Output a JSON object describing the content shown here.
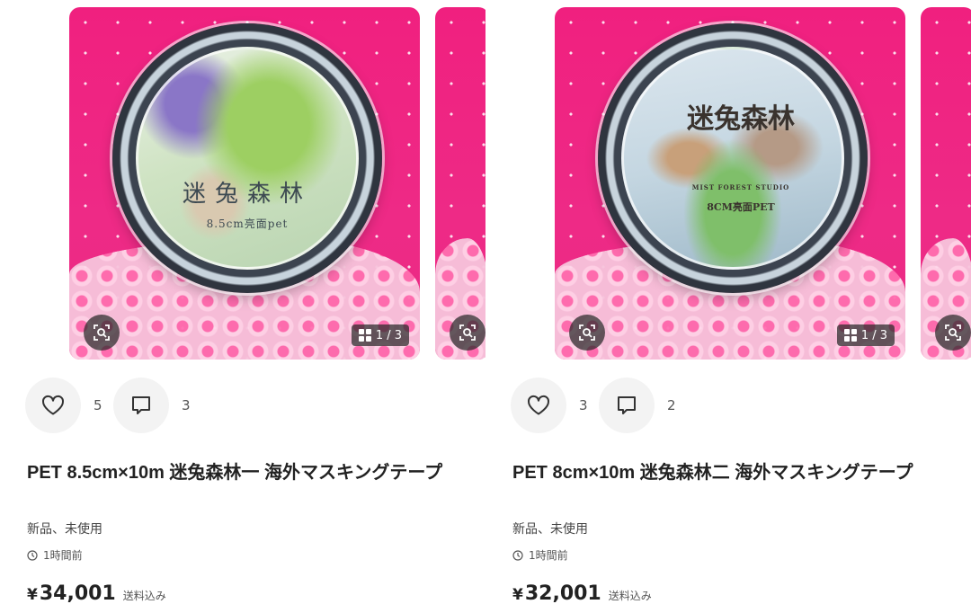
{
  "items": [
    {
      "image": {
        "tape_title": "迷兔森林",
        "tape_subtitle": "8.5cm亮面pet",
        "counter": "1 / 3"
      },
      "likes": "5",
      "comments": "3",
      "title": "PET 8.5cm×10m 迷兔森林一 海外マスキングテープ",
      "condition": "新品、未使用",
      "time": "1時間前",
      "price_symbol": "¥",
      "price": "34,001",
      "shipping": "送料込み"
    },
    {
      "image": {
        "tape_title": "迷兔森林",
        "tape_studio": "MIST FOREST STUDIO",
        "tape_subtitle": "8CM亮面PET",
        "counter": "1 / 3"
      },
      "likes": "3",
      "comments": "2",
      "title": "PET 8cm×10m 迷兔森林二 海外マスキングテープ",
      "condition": "新品、未使用",
      "time": "1時間前",
      "price_symbol": "¥",
      "price": "32,001",
      "shipping": "送料込み"
    }
  ],
  "icons": {
    "zoom": "image-search-icon",
    "gallery": "gallery-grid-icon",
    "like": "heart-icon",
    "comment": "comment-icon",
    "time": "clock-icon"
  },
  "colors": {
    "background_pink": "#ee2a86",
    "text": "#222222",
    "button_bg": "#f3f3f3"
  }
}
